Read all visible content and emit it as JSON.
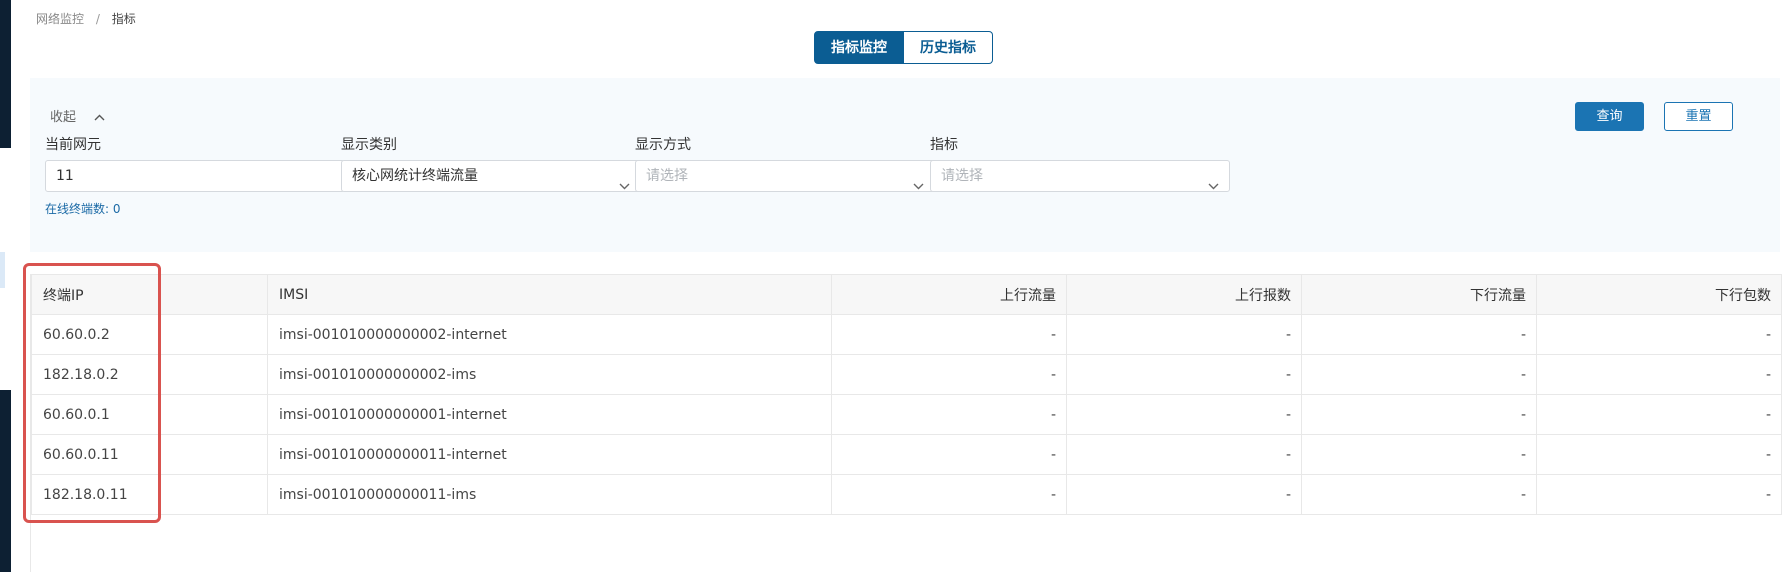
{
  "breadcrumb": {
    "parent": "网络监控",
    "separator": "/",
    "current": "指标"
  },
  "tabs": [
    {
      "label": "指标监控",
      "active": true
    },
    {
      "label": "历史指标",
      "active": false
    }
  ],
  "filter": {
    "collapse_label": "收起",
    "query_label": "查询",
    "reset_label": "重置",
    "network_element": {
      "label": "当前网元",
      "value": "11"
    },
    "online_count": "在线终端数: 0",
    "display_category": {
      "label": "显示类别",
      "value": "核心网统计终端流量"
    },
    "display_mode": {
      "label": "显示方式",
      "placeholder": "请选择"
    },
    "metric": {
      "label": "指标",
      "placeholder": "请选择"
    }
  },
  "table": {
    "columns": [
      "终端IP",
      "IMSI",
      "上行流量",
      "上行报数",
      "下行流量",
      "下行包数"
    ],
    "rows": [
      [
        "60.60.0.2",
        "imsi-001010000000002-internet",
        "-",
        "-",
        "-",
        "-"
      ],
      [
        "182.18.0.2",
        "imsi-001010000000002-ims",
        "-",
        "-",
        "-",
        "-"
      ],
      [
        "60.60.0.1",
        "imsi-001010000000001-internet",
        "-",
        "-",
        "-",
        "-"
      ],
      [
        "60.60.0.11",
        "imsi-001010000000011-internet",
        "-",
        "-",
        "-",
        "-"
      ],
      [
        "182.18.0.11",
        "imsi-001010000000011-ims",
        "-",
        "-",
        "-",
        "-"
      ]
    ]
  },
  "colors": {
    "primary": "#0b5d93",
    "button": "#1b74b3",
    "highlight": "#d9534f",
    "panel_bg": "#f6fafd"
  }
}
